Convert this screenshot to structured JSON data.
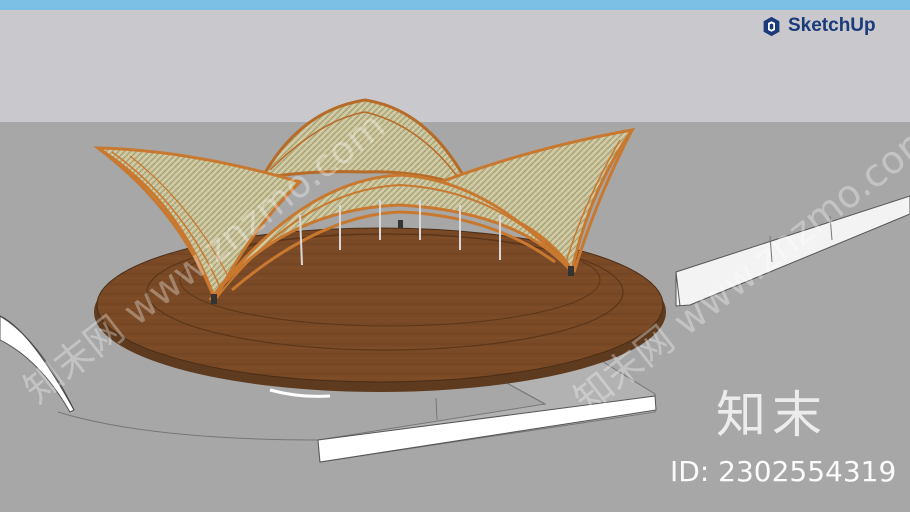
{
  "brand": {
    "name": "SketchUp",
    "logo_icon": "sketchup-logo-icon",
    "color": "#1a3a7a"
  },
  "watermark": {
    "site_cn": "知末",
    "id_text": "ID: 2302554319",
    "diagonal_text": "知末网 www.znzmo.com"
  },
  "colors": {
    "sky": "#c9c9cd",
    "ground": "#a7a7a7",
    "stage_wood": "#7a4a26",
    "frame_orange": "#c8782f",
    "thatch": "#c9c39a"
  }
}
